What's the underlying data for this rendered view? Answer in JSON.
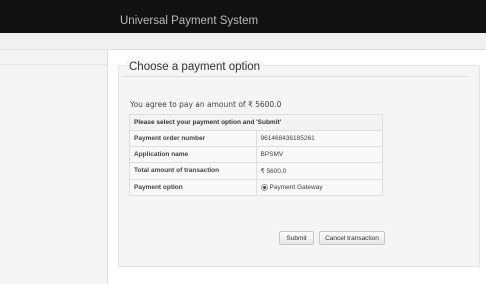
{
  "header": {
    "app_title": "Universal Payment System"
  },
  "panel": {
    "legend": "Choose a payment option",
    "agree_text": "You agree to pay an amount of ₹ 5600.0",
    "table": {
      "header": "Please select your payment option and 'Submit'",
      "rows": [
        {
          "label": "Payment order number",
          "value": "961468436185261"
        },
        {
          "label": "Application name",
          "value": "BPSMV"
        },
        {
          "label": "Total amount of transaction",
          "value": "₹ 5600.0"
        }
      ],
      "payment_option": {
        "label": "Payment option",
        "value": "Payment Gateway",
        "selected": true
      }
    },
    "buttons": {
      "submit": "Submit",
      "cancel": "Cancel transaction"
    }
  }
}
